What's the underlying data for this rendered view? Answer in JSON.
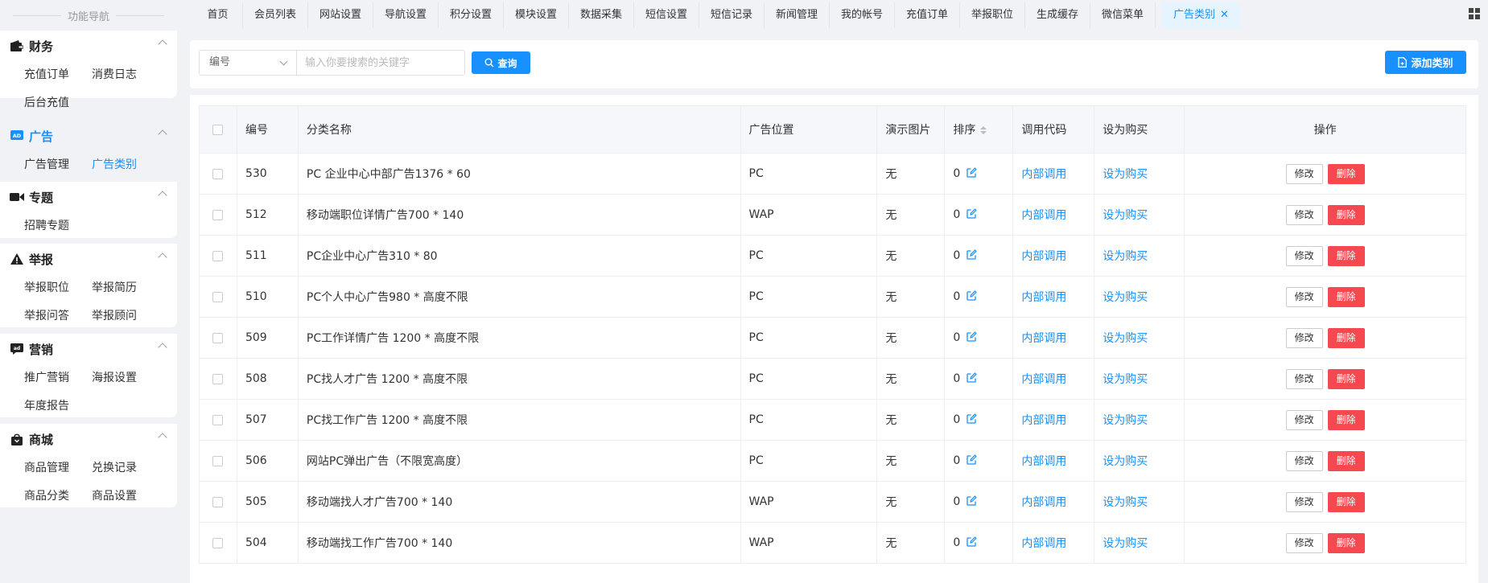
{
  "sidebar": {
    "nav_title": "功能导航",
    "groups": [
      {
        "label": "财务",
        "icon": "wallet-icon",
        "items": [
          "充值订单",
          "消费日志",
          "后台充值"
        ]
      },
      {
        "label": "广告",
        "icon": "ad-icon",
        "items": [
          "广告管理",
          "广告类别"
        ]
      },
      {
        "label": "专题",
        "icon": "video-icon",
        "items": [
          "招聘专题"
        ]
      },
      {
        "label": "举报",
        "icon": "warning-icon",
        "items": [
          "举报职位",
          "举报简历",
          "举报问答",
          "举报顾问"
        ]
      },
      {
        "label": "营销",
        "icon": "marketing-icon",
        "items": [
          "推广营销",
          "海报设置",
          "年度报告"
        ]
      },
      {
        "label": "商城",
        "icon": "shop-icon",
        "items": [
          "商品管理",
          "兑换记录",
          "商品分类",
          "商品设置"
        ]
      }
    ]
  },
  "tabs": [
    "首页",
    "会员列表",
    "网站设置",
    "导航设置",
    "积分设置",
    "模块设置",
    "数据采集",
    "短信设置",
    "短信记录",
    "新闻管理",
    "我的帐号",
    "充值订单",
    "举报职位",
    "生成缓存",
    "微信菜单",
    "广告类别"
  ],
  "search": {
    "select_value": "编号",
    "placeholder": "输入你要搜索的关键字",
    "query_label": "查询",
    "add_label": "添加类别"
  },
  "table": {
    "headers": [
      "编号",
      "分类名称",
      "广告位置",
      "演示图片",
      "排序",
      "调用代码",
      "设为购买",
      "操作"
    ],
    "rows": [
      {
        "id": "530",
        "name": "PC 企业中心中部广告1376 * 60",
        "position": "PC",
        "image": "无",
        "sort": "0"
      },
      {
        "id": "512",
        "name": "移动端职位详情广告700 * 140",
        "position": "WAP",
        "image": "无",
        "sort": "0"
      },
      {
        "id": "511",
        "name": "PC企业中心广告310 * 80",
        "position": "PC",
        "image": "无",
        "sort": "0"
      },
      {
        "id": "510",
        "name": "PC个人中心广告980 * 高度不限",
        "position": "PC",
        "image": "无",
        "sort": "0"
      },
      {
        "id": "509",
        "name": "PC工作详情广告 1200 * 高度不限",
        "position": "PC",
        "image": "无",
        "sort": "0"
      },
      {
        "id": "508",
        "name": "PC找人才广告 1200 * 高度不限",
        "position": "PC",
        "image": "无",
        "sort": "0"
      },
      {
        "id": "507",
        "name": "PC找工作广告 1200 * 高度不限",
        "position": "PC",
        "image": "无",
        "sort": "0"
      },
      {
        "id": "506",
        "name": "网站PC弹出广告（不限宽高度）",
        "position": "PC",
        "image": "无",
        "sort": "0"
      },
      {
        "id": "505",
        "name": "移动端找人才广告700 * 140",
        "position": "WAP",
        "image": "无",
        "sort": "0"
      },
      {
        "id": "504",
        "name": "移动端找工作广告700 * 140",
        "position": "WAP",
        "image": "无",
        "sort": "0"
      }
    ],
    "code_link": "内部调用",
    "buy_link": "设为购买",
    "edit_label": "修改",
    "delete_label": "删除"
  },
  "colors": {
    "accent": "#1890ff",
    "danger": "#f5484f"
  }
}
